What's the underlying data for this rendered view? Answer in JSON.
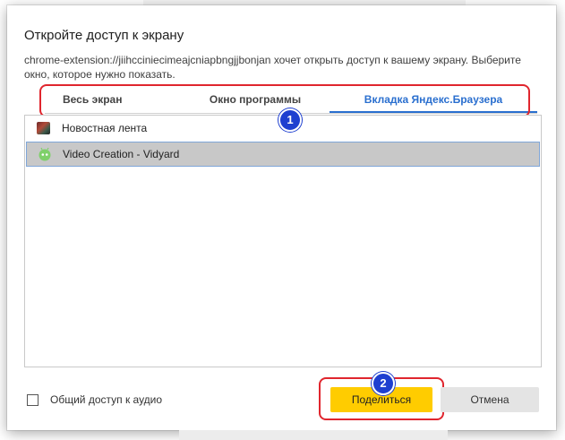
{
  "dialog": {
    "title": "Откройте доступ к экрану",
    "description": "chrome-extension://jiihcciniecimeajcniapbngjjbonjan хочет открыть доступ к вашему экрану. Выберите окно, которое нужно показать."
  },
  "tabs": [
    {
      "label": "Весь экран",
      "active": false
    },
    {
      "label": "Окно программы",
      "active": false
    },
    {
      "label": "Вкладка Яндекс.Браузера",
      "active": true
    }
  ],
  "list": [
    {
      "label": "Новостная лента",
      "icon": "news-favicon",
      "selected": false
    },
    {
      "label": "Video Creation - Vidyard",
      "icon": "vidyard-favicon",
      "selected": true
    }
  ],
  "audio": {
    "label": "Общий доступ к аудио",
    "checked": false
  },
  "buttons": {
    "share": "Поделиться",
    "cancel": "Отмена"
  },
  "annotations": {
    "badge1": "1",
    "badge2": "2"
  },
  "colors": {
    "accent": "#2a6fcf",
    "share": "#ffcc00",
    "highlight": "#e0262e",
    "badge": "#1e3fd0"
  }
}
